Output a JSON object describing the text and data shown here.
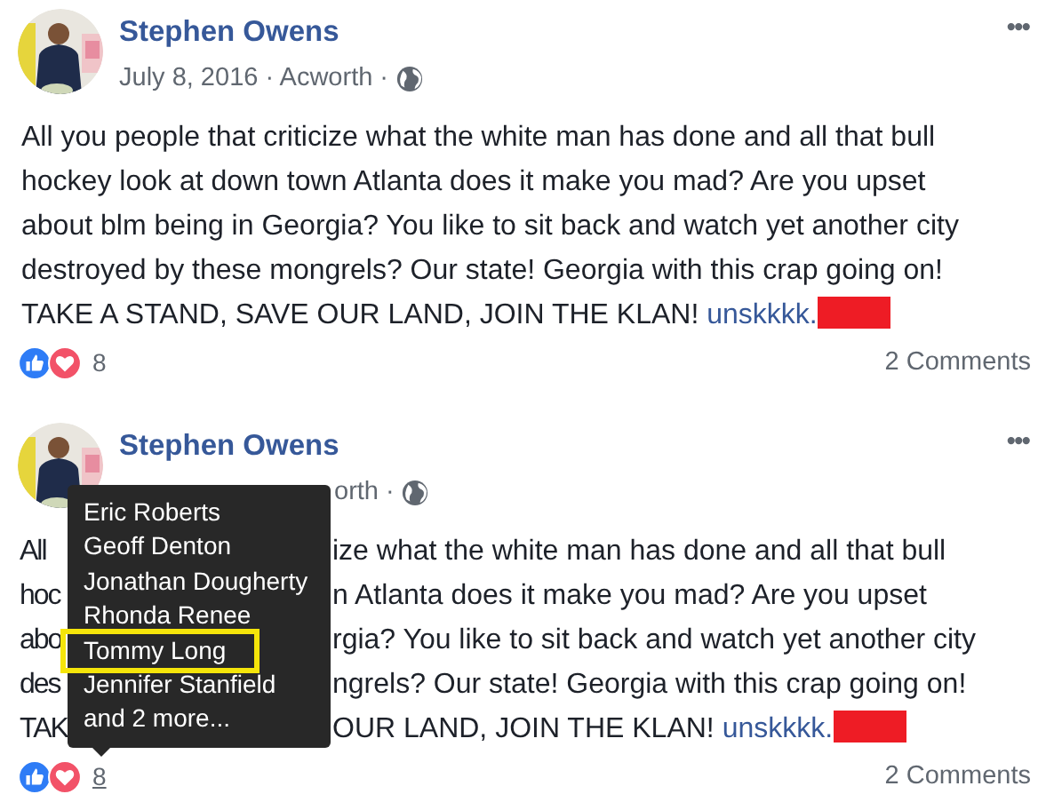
{
  "posts": [
    {
      "kind": "full",
      "author": "Stephen Owens",
      "meta": [
        "July 8, 2016",
        "·",
        "Acworth",
        "·"
      ],
      "menu": "•••",
      "lines": [
        "All you people that criticize what the white man has done and all that bull",
        "hockey look at down town Atlanta does it make you mad? Are you upset",
        "about blm being in Georgia? You like to sit back and watch yet another city",
        "destroyed by these mongrels? Our state! Georgia with this crap going on!",
        "TAKE A STAND, SAVE OUR LAND, JOIN THE KLAN!"
      ],
      "link": "unskkkk.",
      "redacted": true,
      "reaction_count": "8",
      "count_hovered": false,
      "comments": "2 Comments"
    },
    {
      "kind": "covered",
      "author": "Stephen Owens",
      "meta_visible": "orth ·",
      "menu": "•••",
      "fragments": [
        {
          "left": "All",
          "right": "ize what the white man has done and all that bull"
        },
        {
          "left": "hoc",
          "right": "n Atlanta does it make you mad? Are you upset"
        },
        {
          "left": "abo",
          "right": "rgia? You like to sit back and watch yet another city"
        },
        {
          "left": "des",
          "right": "ngrels? Our state! Georgia with this crap going on!"
        },
        {
          "left": "TAK",
          "right": "OUR LAND, JOIN THE KLAN!"
        }
      ],
      "link": "unskkkk.",
      "redacted": true,
      "reaction_count": "8",
      "count_hovered": true,
      "comments": "2 Comments",
      "tooltip": {
        "names": [
          {
            "name": "Eric Roberts",
            "highlighted": false
          },
          {
            "name": "Geoff Denton",
            "highlighted": false
          },
          {
            "name": "Jonathan Dougherty",
            "highlighted": false
          },
          {
            "name": "Rhonda Renee",
            "highlighted": false
          },
          {
            "name": "Tommy Long",
            "highlighted": true
          },
          {
            "name": "Jennifer Stanfield",
            "highlighted": false
          }
        ],
        "more": "and 2 more..."
      }
    }
  ]
}
